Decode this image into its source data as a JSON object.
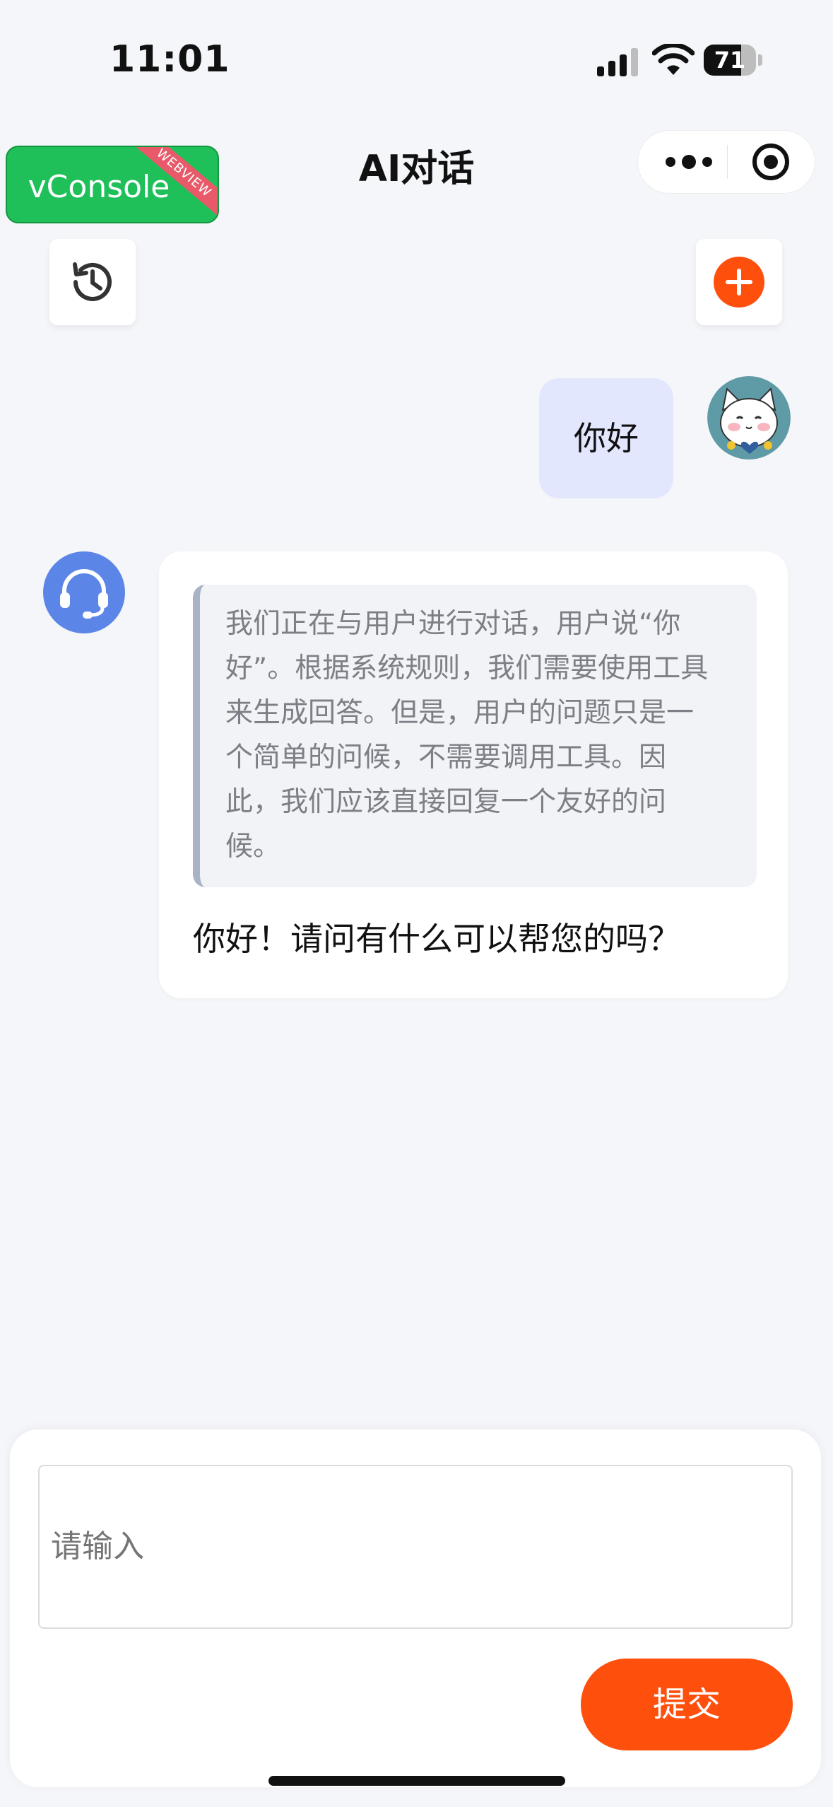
{
  "status_bar": {
    "time": "11:01",
    "battery": "71"
  },
  "nav": {
    "vconsole_label": "vConsole",
    "vconsole_ribbon": "WEBVIEW",
    "title": "AI对话"
  },
  "toolbar": {
    "history_icon": "history-icon",
    "new_chat_icon": "plus-circle-icon",
    "accent_color": "#ff4f0d"
  },
  "messages": {
    "user_text": "你好",
    "ai_thinking": "我们正在与用户进行对话，用户说“你好”。根据系统规则，我们需要使用工具来生成回答。但是，用户的问题只是一个简单的问候，不需要调用工具。因此，我们应该直接回复一个友好的问候。",
    "ai_answer": "你好！请问有什么可以帮您的吗？"
  },
  "composer": {
    "placeholder": "请输入",
    "submit_label": "提交"
  }
}
